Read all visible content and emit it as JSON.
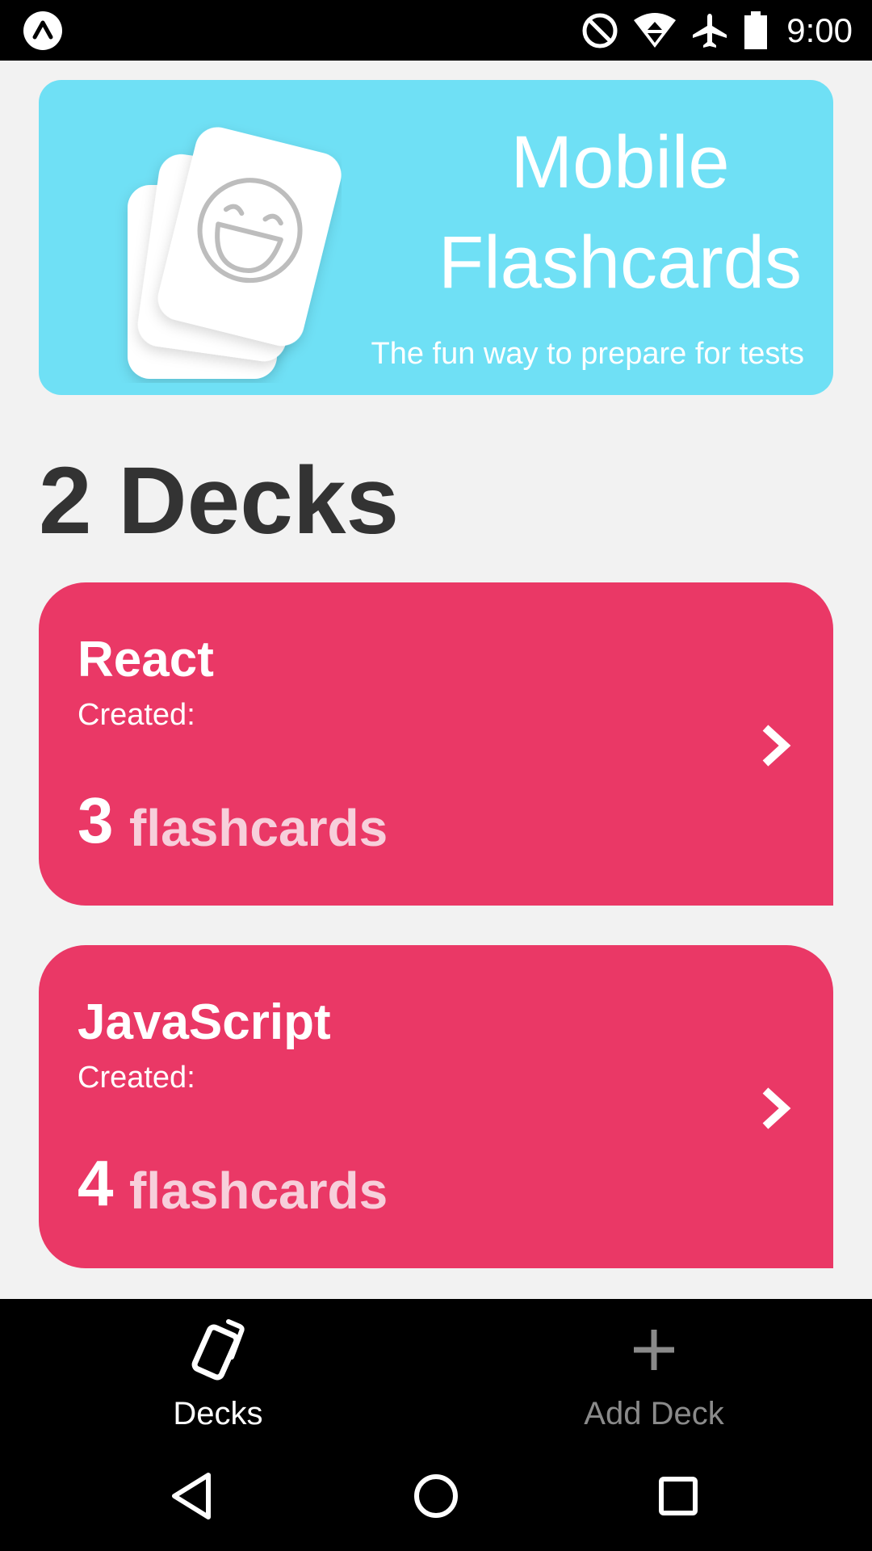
{
  "status_bar": {
    "time": "9:00",
    "icons": [
      "expo-icon",
      "do-not-disturb-icon",
      "wifi-icon",
      "airplane-mode-icon",
      "battery-icon"
    ]
  },
  "banner": {
    "title": "Mobile Flashcards",
    "subtitle": "The fun way to prepare for tests",
    "background_color": "#6fe0f5",
    "logo_icon": "flashcards-smiley-logo"
  },
  "decks_heading": "2 Decks",
  "decks": [
    {
      "name": "React",
      "created_label": "Created:",
      "card_count": "3",
      "card_count_label": "flashcards"
    },
    {
      "name": "JavaScript",
      "created_label": "Created:",
      "card_count": "4",
      "card_count_label": "flashcards"
    }
  ],
  "deck_card_color": "#ea3866",
  "tab_bar": {
    "tabs": [
      {
        "label": "Decks",
        "icon": "cards-icon",
        "active": true
      },
      {
        "label": "Add Deck",
        "icon": "plus-icon",
        "active": false
      }
    ]
  },
  "nav_bar": {
    "buttons": [
      "back-icon",
      "home-icon",
      "recents-icon"
    ]
  }
}
